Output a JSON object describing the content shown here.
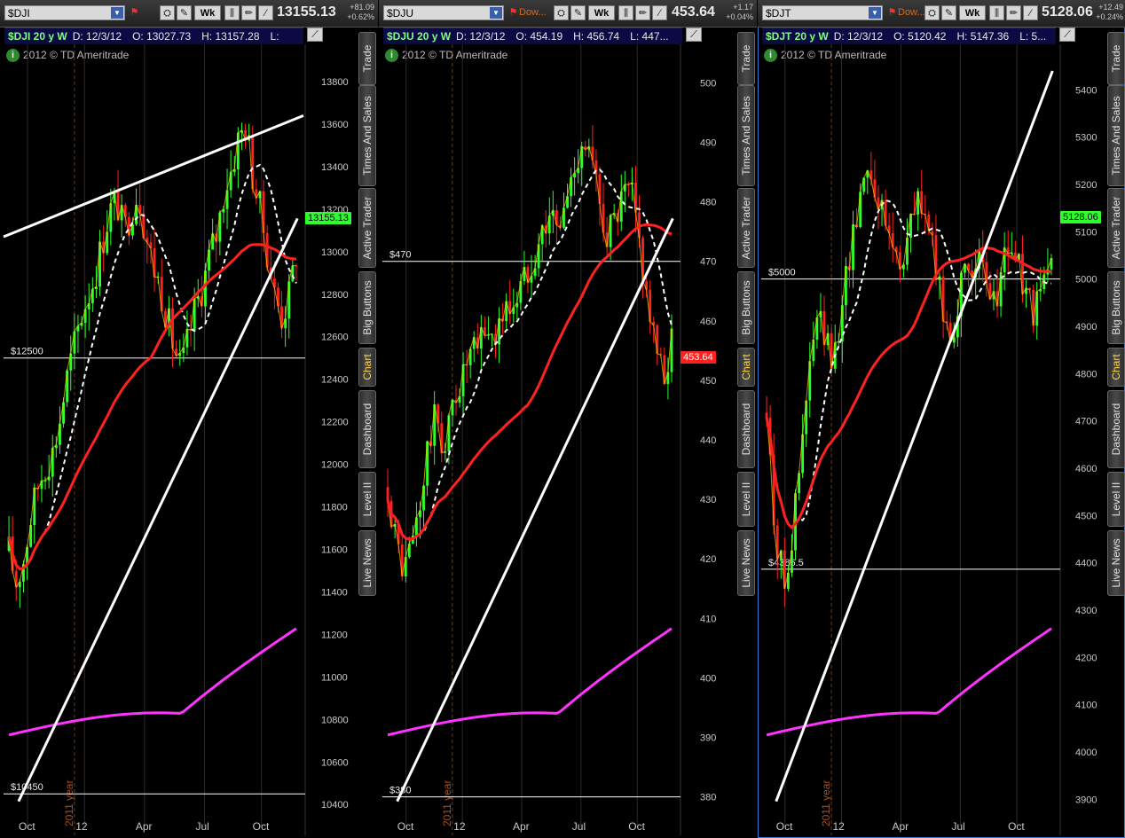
{
  "panels": [
    {
      "symbol": "$DJI",
      "desc": "",
      "price": "13155.13",
      "change1": "+81.09",
      "change2": "+0.62%",
      "header": {
        "study": "$DJI 20 y W",
        "date": "D: 12/3/12",
        "open": "O: 13027.73",
        "high": "H: 13157.28",
        "low": "L:"
      },
      "copyright": "2012 © TD Ameritrade",
      "last_tag": "13155.13",
      "tag_color": "#2cff2c",
      "hlines": [
        {
          "label": "$12500",
          "value": 12500
        },
        {
          "label": "$10450",
          "value": 10450
        }
      ],
      "yticks": [
        10400,
        10600,
        10800,
        11000,
        11200,
        11400,
        11600,
        11800,
        12000,
        12200,
        12400,
        12600,
        12800,
        13000,
        13200,
        13400,
        13600,
        13800
      ],
      "ylim": [
        10380,
        13850
      ],
      "xticks": [
        "Oct",
        "12",
        "Apr",
        "Jul",
        "Oct"
      ],
      "year_label": "2011 year"
    },
    {
      "symbol": "$DJU",
      "desc": "Dow...",
      "price": "453.64",
      "change1": "+1.17",
      "change2": "+0.04%",
      "header": {
        "study": "$DJU 20 y W",
        "date": "D: 12/3/12",
        "open": "O: 454.19",
        "high": "H: 456.74",
        "low": "L: 447..."
      },
      "copyright": "2012 © TD Ameritrade",
      "last_tag": "453.64",
      "tag_color": "#ff2020",
      "hlines": [
        {
          "label": "$470",
          "value": 470
        },
        {
          "label": "$380",
          "value": 380
        }
      ],
      "yticks": [
        380,
        390,
        400,
        410,
        420,
        430,
        440,
        450,
        460,
        470,
        480,
        490,
        500
      ],
      "ylim": [
        378,
        502
      ],
      "xticks": [
        "Oct",
        "12",
        "Apr",
        "Jul",
        "Oct"
      ],
      "year_label": "2011 year"
    },
    {
      "symbol": "$DJT",
      "desc": "Dow...",
      "price": "5128.06",
      "change1": "+12.49",
      "change2": "+0.24%",
      "header": {
        "study": "$DJT 20 y W",
        "date": "D: 12/3/12",
        "open": "O: 5120.42",
        "high": "H: 5147.36",
        "low": "L: 5..."
      },
      "copyright": "2012 © TD Ameritrade",
      "last_tag": "5128.06",
      "tag_color": "#2cff2c",
      "hlines": [
        {
          "label": "$5000",
          "value": 5000
        },
        {
          "label": "$4386.5",
          "value": 4386.5
        }
      ],
      "yticks": [
        3900,
        4000,
        4100,
        4200,
        4300,
        4400,
        4500,
        4600,
        4700,
        4800,
        4900,
        5000,
        5100,
        5200,
        5300,
        5400
      ],
      "ylim": [
        3880,
        5440
      ],
      "xticks": [
        "Oct",
        "12",
        "Apr",
        "Jul",
        "Oct"
      ],
      "year_label": "2011 year"
    }
  ],
  "toolbar": {
    "wk_label": "Wk"
  },
  "side_tabs": [
    "Trade",
    "Times And Sales",
    "Active Trader",
    "Big Buttons",
    "Chart",
    "Dashboard",
    "Level II",
    "Live News"
  ],
  "active_tab": "Chart",
  "colors": {
    "ma_red": "#ff2020",
    "ma_magenta": "#ff33ff",
    "ma_white": "#ffffff",
    "up": "#2cff2c",
    "down": "#ff2020",
    "trend": "#ffffff"
  }
}
